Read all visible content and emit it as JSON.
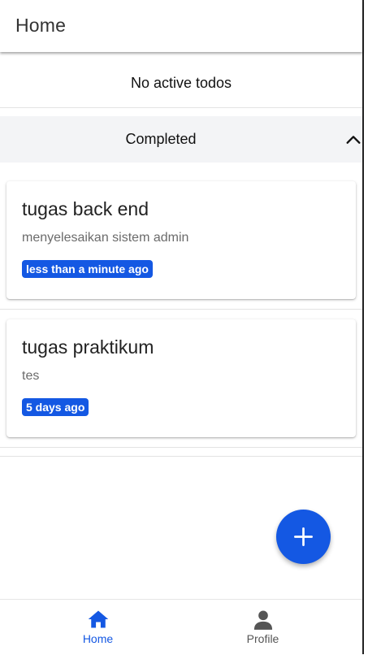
{
  "colors": {
    "accent": "#1458e3",
    "inactive_nav": "#555555",
    "section_bg": "#f3f4f6"
  },
  "appbar": {
    "title": "Home"
  },
  "active": {
    "empty_message": "No active todos"
  },
  "completed": {
    "label": "Completed",
    "toggle_icon": "chevron-up-icon",
    "items": [
      {
        "title": "tugas back end",
        "description": "menyelesaikan sistem admin",
        "time": "less than a minute ago"
      },
      {
        "title": "tugas praktikum",
        "description": "tes",
        "time": "5 days ago"
      }
    ]
  },
  "fab": {
    "icon": "plus-icon"
  },
  "bottom_nav": {
    "items": [
      {
        "label": "Home",
        "icon": "home-icon",
        "active": true
      },
      {
        "label": "Profile",
        "icon": "person-icon",
        "active": false
      }
    ]
  }
}
